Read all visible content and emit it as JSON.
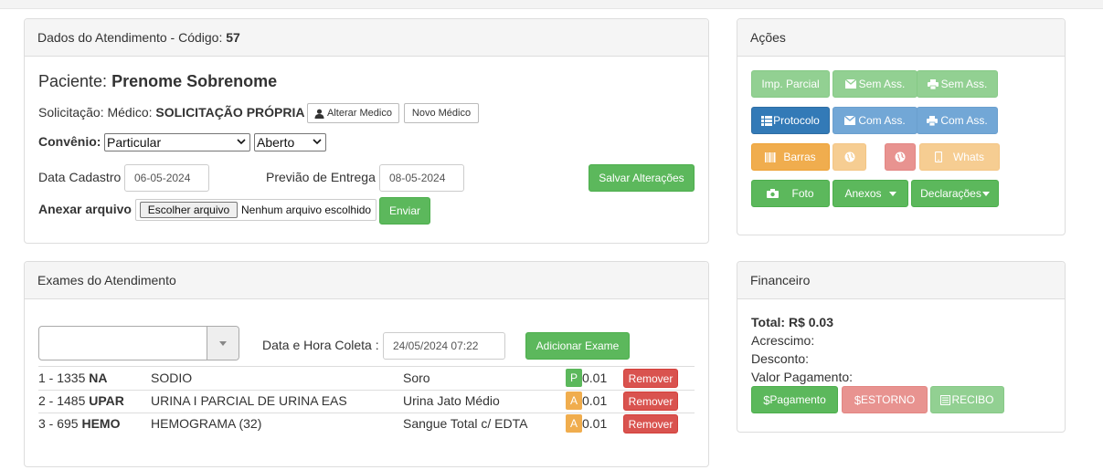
{
  "atendimento": {
    "heading_prefix": "Dados do Atendimento - Código:",
    "codigo": "57",
    "paciente_label": "Paciente:",
    "paciente_nome": "Prenome Sobrenome",
    "solicitacao_label": "Solicitação: Médico:",
    "medico": "SOLICITAÇÃO PRÓPRIA",
    "alterar_medico": "Alterar Medico",
    "novo_medico": "Novo Médico",
    "convenio_label": "Convênio:",
    "convenio_value": "Particular",
    "status_value": "Aberto",
    "data_cadastro_label": "Data Cadastro",
    "data_cadastro": "06-05-2024",
    "previsao_label": "Previão de Entrega",
    "previsao": "08-05-2024",
    "salvar": "Salvar Alterações",
    "anexar_label": "Anexar arquivo",
    "escolher_arquivo": "Escolher arquivo",
    "nenhum_arquivo": "Nenhum arquivo escolhido",
    "enviar": "Enviar"
  },
  "acoes": {
    "heading": "Ações",
    "imp_parcial": "Imp. Parcial",
    "sem_ass_mail": "Sem Ass.",
    "sem_ass_print": "Sem Ass.",
    "protocolo": "Protocolo",
    "com_ass_mail": "Com Ass.",
    "com_ass_print": "Com Ass.",
    "barras": "Barras",
    "whats": "Whats",
    "foto": "Foto",
    "anexos": "Anexos",
    "declaracoes": "Declarações"
  },
  "exames": {
    "heading": "Exames do Atendimento",
    "coleta_label": "Data e Hora Coleta :",
    "coleta_value": "24/05/2024 07:22",
    "adicionar": "Adicionar Exame",
    "remover": "Remover",
    "rows": [
      {
        "num": "1 - 1335",
        "code": "NA",
        "name": "SODIO",
        "material": "Soro",
        "status": "P",
        "status_color": "#5cb85c",
        "price": "0.01"
      },
      {
        "num": "2 - 1485",
        "code": "UPAR",
        "name": "URINA I PARCIAL DE URINA EAS",
        "material": "Urina Jato Médio",
        "status": "A",
        "status_color": "#f0ad4e",
        "price": "0.01"
      },
      {
        "num": "3 - 695",
        "code": "HEMO",
        "name": "HEMOGRAMA (32)",
        "material": "Sangue Total c/ EDTA",
        "status": "A",
        "status_color": "#f0ad4e",
        "price": "0.01"
      }
    ]
  },
  "financeiro": {
    "heading": "Financeiro",
    "total": "Total: R$ 0.03",
    "acrescimo": "Acrescimo:",
    "desconto": "Desconto:",
    "valor_pagamento": "Valor Pagamento:",
    "pagamento": "Pagamento",
    "estorno": "ESTORNO",
    "recibo": "RECIBO"
  },
  "icons": [
    "envelope-icon",
    "print-icon",
    "list-icon",
    "barcode-icon",
    "globe-icon",
    "phone-icon",
    "camera-icon",
    "user-icon",
    "dollar-icon",
    "receipt-icon",
    "caret-down-icon"
  ]
}
